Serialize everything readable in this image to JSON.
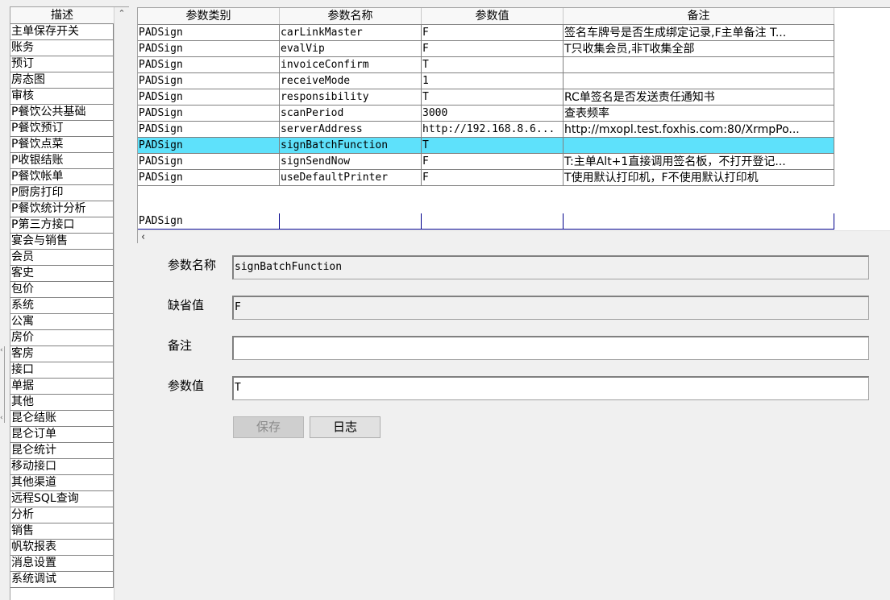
{
  "left": {
    "header": "描述",
    "items": [
      "主单保存开关",
      "账务",
      "预订",
      "房态图",
      "审核",
      "P餐饮公共基础",
      "P餐饮预订",
      "P餐饮点菜",
      "P收银结账",
      "P餐饮帐单",
      "P厨房打印",
      "P餐饮统计分析",
      "P第三方接口",
      "宴会与销售",
      "会员",
      "客史",
      "包价",
      "系统",
      "公寓",
      "房价",
      "客房",
      "接口",
      "单据",
      "其他",
      "昆仑结账",
      "昆仑订单",
      "昆仑统计",
      "移动接口",
      "其他渠道",
      "远程SQL查询",
      "分析",
      "销售",
      "帆软报表",
      "消息设置",
      "系统调试"
    ]
  },
  "grid": {
    "columns": [
      "参数类别",
      "参数名称",
      "参数值",
      "备注"
    ],
    "rows": [
      [
        "PADSign",
        "carLinkMaster",
        "F",
        "签名车牌号是否生成绑定记录,F主单备注 T..."
      ],
      [
        "PADSign",
        "evalVip",
        "F",
        "T只收集会员,非T收集全部"
      ],
      [
        "PADSign",
        "invoiceConfirm",
        "T",
        ""
      ],
      [
        "PADSign",
        "receiveMode",
        "1",
        ""
      ],
      [
        "PADSign",
        "responsibility",
        "T",
        "RC单签名是否发送责任通知书"
      ],
      [
        "PADSign",
        "scanPeriod",
        "3000",
        "查表频率"
      ],
      [
        "PADSign",
        "serverAddress",
        "http://192.168.8.6...",
        "http://mxopl.test.foxhis.com:80/XrmpPo..."
      ],
      [
        "PADSign",
        "signBatchFunction",
        "T",
        ""
      ],
      [
        "PADSign",
        "signSendNow",
        "F",
        "T:主单Alt+1直接调用签名板，不打开登记..."
      ],
      [
        "PADSign",
        "useDefaultPrinter",
        "F",
        "T使用默认打印机，F不使用默认打印机"
      ]
    ],
    "selected_row": "signBatchFunction",
    "new_row": [
      "PADSign",
      "",
      "",
      ""
    ],
    "selected_color": "#5ee1fb"
  },
  "form": {
    "name_label": "参数名称",
    "name_value": "signBatchFunction",
    "default_label": "缺省值",
    "default_value": "F",
    "remark_label": "备注",
    "remark_value": "",
    "value_label": "参数值",
    "value_value": "T",
    "save_label": "保存",
    "log_label": "日志"
  },
  "icons": {
    "left_scroll_up": "chevron-up-icon",
    "grid_scroll_left": "chevron-left-icon",
    "splitter": "collapse-arrows-icon"
  }
}
